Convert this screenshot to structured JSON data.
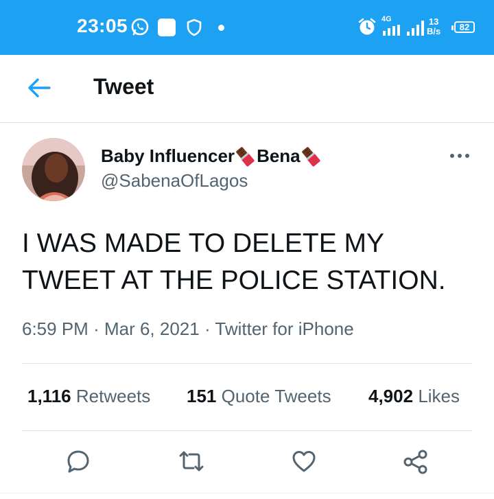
{
  "status_bar": {
    "time": "23:05",
    "network": "4G",
    "speed_value": "13",
    "speed_unit": "B/s",
    "battery": "82",
    "icons": [
      "whatsapp-icon",
      "notification-square-icon",
      "shield-icon",
      "dot-icon",
      "alarm-icon",
      "signal-icon",
      "signal-icon",
      "battery-icon"
    ]
  },
  "header": {
    "title": "Tweet",
    "back_icon": "arrow-left-icon"
  },
  "tweet": {
    "author_name_part1": "Baby Influencer ",
    "author_name_part2": "Bena ",
    "emoji_icon": "chocolate-bar-icon",
    "handle": "@SabenaOfLagos",
    "text": "I WAS MADE TO DELETE MY TWEET AT THE POLICE STATION.",
    "time": "6:59 PM",
    "date": "Mar 6, 2021",
    "source": "Twitter for iPhone",
    "separator": "·"
  },
  "stats": {
    "retweets_count": "1,116",
    "retweets_label": "Retweets",
    "quotes_count": "151",
    "quotes_label": "Quote Tweets",
    "likes_count": "4,902",
    "likes_label": "Likes"
  },
  "actions": [
    "reply-icon",
    "retweet-icon",
    "like-icon",
    "share-icon"
  ],
  "colors": {
    "accent": "#1da1f2",
    "text_primary": "#0f1419",
    "text_secondary": "#536471",
    "divider": "#dfe3e6"
  }
}
